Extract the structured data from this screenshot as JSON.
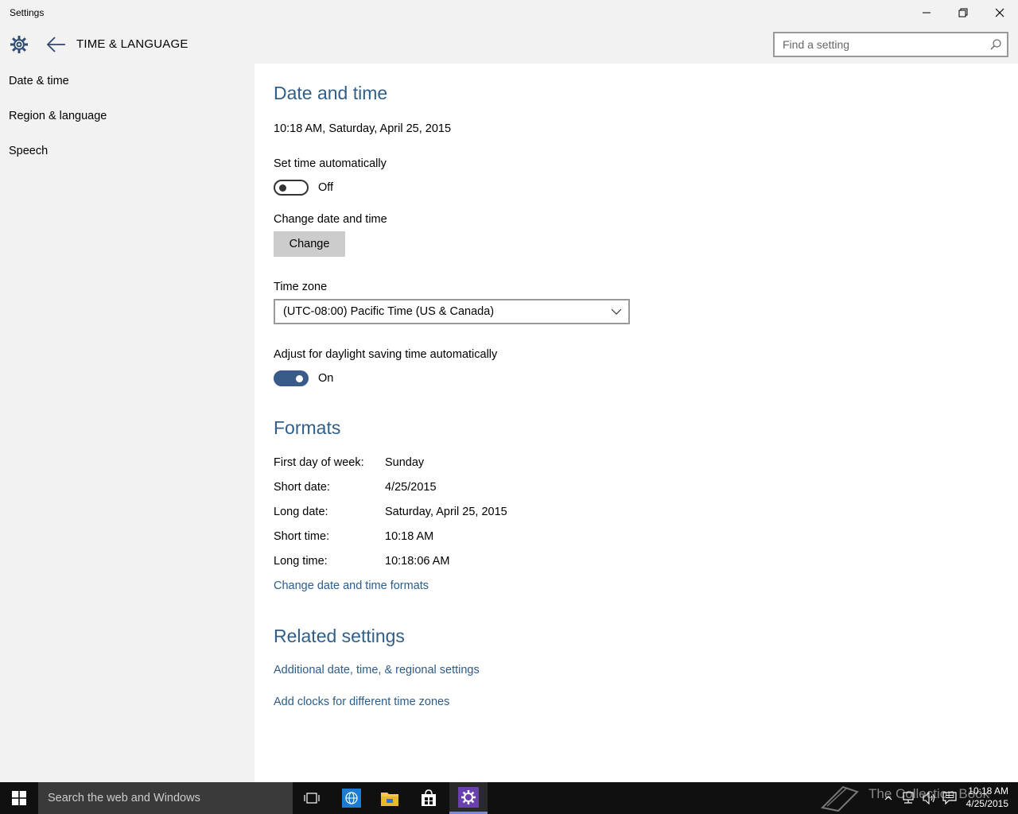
{
  "window": {
    "title": "Settings"
  },
  "header": {
    "section": "TIME & LANGUAGE",
    "search_placeholder": "Find a setting"
  },
  "sidebar": {
    "items": [
      {
        "label": "Date & time"
      },
      {
        "label": "Region & language"
      },
      {
        "label": "Speech"
      }
    ]
  },
  "main": {
    "heading": "Date and time",
    "current_datetime": "10:18 AM, Saturday, April 25, 2015",
    "set_time_auto": {
      "label": "Set time automatically",
      "state": "Off"
    },
    "change_dt": {
      "label": "Change date and time",
      "button": "Change"
    },
    "timezone": {
      "label": "Time zone",
      "value": "(UTC-08:00) Pacific Time (US & Canada)"
    },
    "dst": {
      "label": "Adjust for daylight saving time automatically",
      "state": "On"
    },
    "formats": {
      "heading": "Formats",
      "rows": [
        {
          "label": "First day of week:",
          "value": "Sunday"
        },
        {
          "label": "Short date:",
          "value": "4/25/2015"
        },
        {
          "label": "Long date:",
          "value": "Saturday, April 25, 2015"
        },
        {
          "label": "Short time:",
          "value": "10:18 AM"
        },
        {
          "label": "Long time:",
          "value": "10:18:06 AM"
        }
      ],
      "link": "Change date and time formats"
    },
    "related": {
      "heading": "Related settings",
      "links": [
        "Additional date, time, & regional settings",
        "Add clocks for different time zones"
      ]
    }
  },
  "taskbar": {
    "search_placeholder": "Search the web and Windows",
    "time": "10:18 AM",
    "date": "4/25/2015",
    "watermark": "The Collection Book"
  },
  "colors": {
    "accent": "#2f5f8a",
    "toggle_on": "#3a5a8a",
    "chrome_bg": "#f2f2f2",
    "taskbar_bg": "#101010"
  }
}
